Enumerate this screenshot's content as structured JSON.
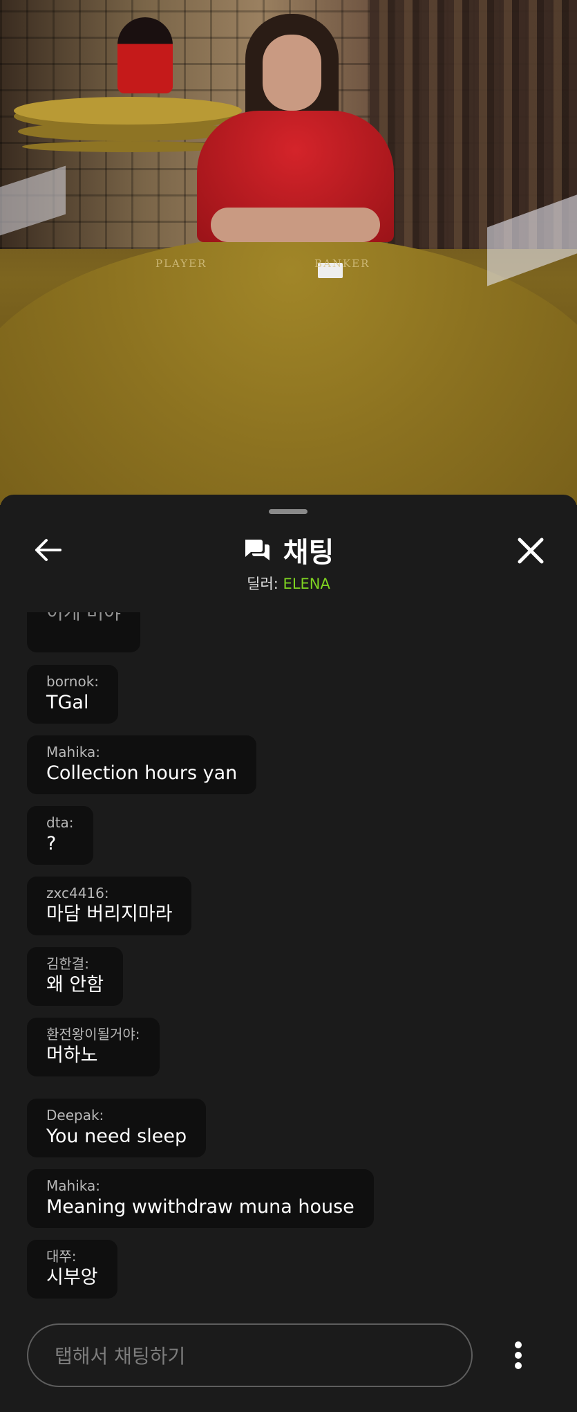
{
  "video": {
    "table_labels": [
      "PLAYER",
      "BANKER"
    ]
  },
  "chat": {
    "title": "채팅",
    "dealer_label": "딜러:",
    "dealer_name": "ELENA",
    "accent_color": "#7ed321",
    "icons": {
      "back": "arrow-left-icon",
      "title": "chat-bubbles-icon",
      "close": "close-icon",
      "more": "more-vertical-icon"
    },
    "messages": [
      {
        "user": "",
        "text": "이게 머야"
      },
      {
        "user": "bornok:",
        "text": "TGal"
      },
      {
        "user": "Mahika:",
        "text": "Collection hours yan"
      },
      {
        "user": "dta:",
        "text": "?"
      },
      {
        "user": "zxc4416:",
        "text": "마담 버리지마라"
      },
      {
        "user": "김한결:",
        "text": "왜 안함"
      },
      {
        "user": "환전왕이될거야:",
        "text": "머하노"
      },
      {
        "user": "Deepak:",
        "text": "You need sleep"
      },
      {
        "user": "Mahika:",
        "text": "Meaning wwithdraw muna house"
      },
      {
        "user": "대쭈:",
        "text": "시부앙"
      }
    ],
    "input_placeholder": "탭해서 채팅하기"
  }
}
